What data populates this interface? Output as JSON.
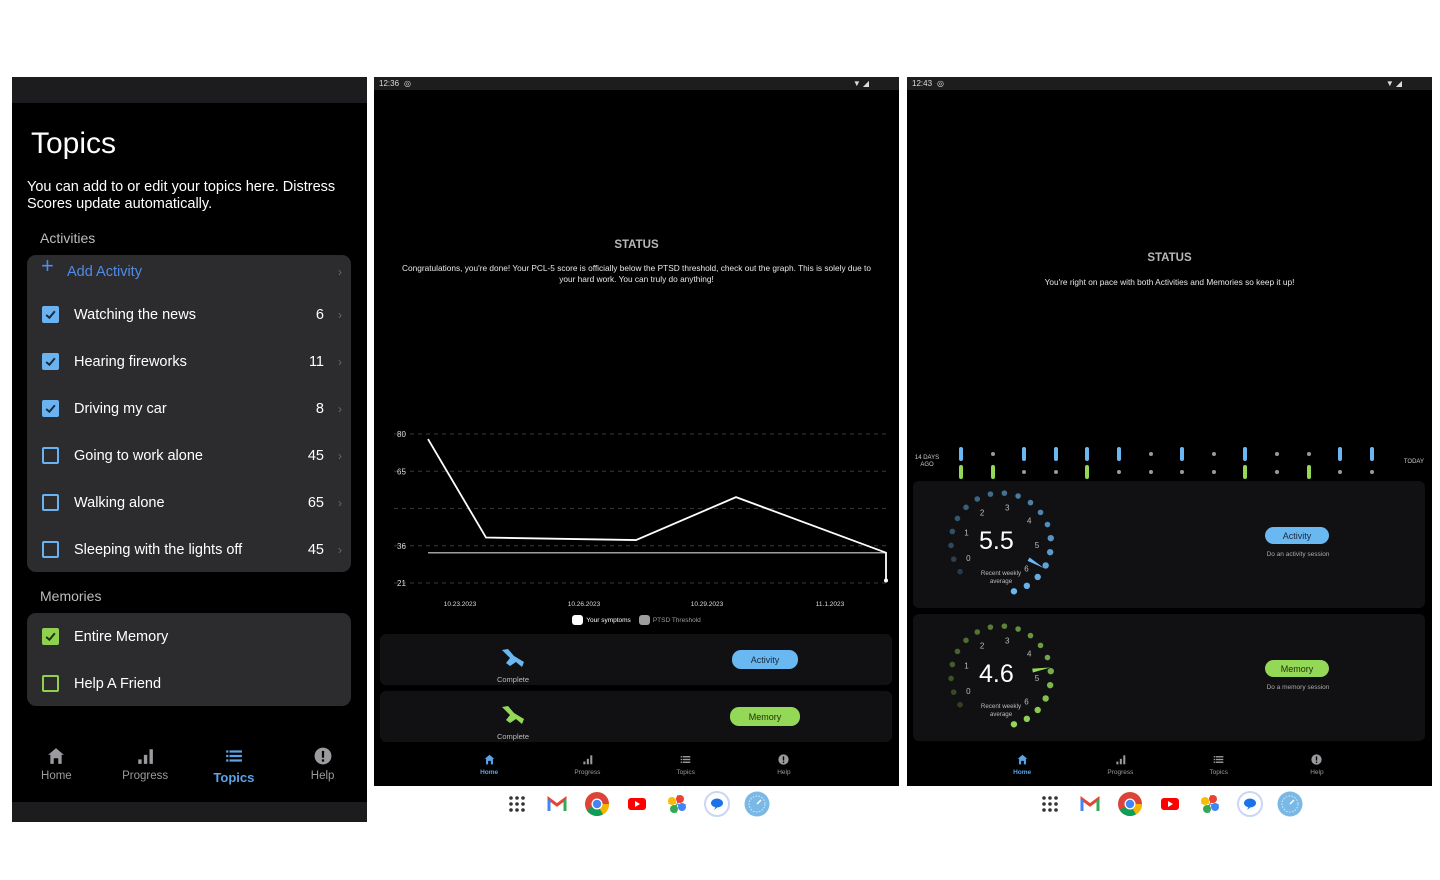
{
  "screen_topics": {
    "title": "Topics",
    "description": "You can add to or edit your topics here. Distress Scores update automatically.",
    "activities_heading": "Activities",
    "add_activity_label": "Add Activity",
    "activities": [
      {
        "label": "Watching the news",
        "score": "6",
        "checked": true
      },
      {
        "label": "Hearing fireworks",
        "score": "11",
        "checked": true
      },
      {
        "label": "Driving my car",
        "score": "8",
        "checked": true
      },
      {
        "label": "Going to work alone",
        "score": "45",
        "checked": false
      },
      {
        "label": "Walking alone",
        "score": "65",
        "checked": false
      },
      {
        "label": "Sleeping with the lights off",
        "score": "45",
        "checked": false
      }
    ],
    "memories_heading": "Memories",
    "memories": [
      {
        "label": "Entire Memory",
        "checked": true
      },
      {
        "label": "Help A Friend",
        "checked": false
      }
    ],
    "nav": [
      {
        "label": "Home",
        "icon": "home-icon",
        "active": false
      },
      {
        "label": "Progress",
        "icon": "bar-chart-icon",
        "active": false
      },
      {
        "label": "Topics",
        "icon": "list-icon",
        "active": true
      },
      {
        "label": "Help",
        "icon": "alert-circle-icon",
        "active": false
      }
    ]
  },
  "screen_home_complete": {
    "status_time": "12:36",
    "status_title": "STATUS",
    "status_text": "Congratulations, you're done! Your PCL-5 score is officially below the PTSD threshold, check out the graph. This is solely due to your hard work. You can truly do anything!",
    "chart_data": {
      "type": "line",
      "title": "",
      "xlabel": "",
      "ylabel": "",
      "ylim": [
        21,
        80
      ],
      "y_ticks": [
        "80",
        "65",
        "",
        "36",
        "21"
      ],
      "x_ticks": [
        "10.23.2023",
        "10.26.2023",
        "10.29.2023",
        "11.1.2023"
      ],
      "grid": true,
      "legend_position": "bottom",
      "series": [
        {
          "name": "Your symptoms",
          "color": "#ffffff",
          "values": [
            78,
            39,
            38,
            55,
            33,
            22
          ]
        },
        {
          "name": "PTSD Threshold",
          "color": "#9e9e9e",
          "values": [
            33,
            33
          ]
        }
      ]
    },
    "sessions": [
      {
        "caption": "Complete",
        "button": "Activity",
        "icon": "bird-icon",
        "color": "blue"
      },
      {
        "caption": "Complete",
        "button": "Memory",
        "icon": "bird-icon",
        "color": "green"
      }
    ],
    "nav": [
      {
        "label": "Home",
        "active": true
      },
      {
        "label": "Progress",
        "active": false
      },
      {
        "label": "Topics",
        "active": false
      },
      {
        "label": "Help",
        "active": false
      }
    ]
  },
  "screen_home_progress": {
    "status_time": "12:43",
    "status_title": "STATUS",
    "status_text": "You're right on pace with both Activities and Memories so keep it up!",
    "streak": {
      "left_label": "14 DAYS AGO",
      "right_label": "TODAY",
      "activity_days": [
        true,
        false,
        true,
        true,
        true,
        true,
        false,
        true,
        false,
        true,
        false,
        false,
        true,
        true
      ],
      "memory_days": [
        true,
        true,
        false,
        false,
        true,
        false,
        false,
        false,
        false,
        true,
        false,
        true,
        false,
        false
      ]
    },
    "gauges": [
      {
        "value": "5.5",
        "numeric": 5.5,
        "max": 6.5,
        "caption": "Recent weekly average",
        "button": "Activity",
        "subtitle": "Do an activity session",
        "color": "#6ab8f2"
      },
      {
        "value": "4.6",
        "numeric": 4.6,
        "max": 6.5,
        "caption": "Recent weekly average",
        "button": "Memory",
        "subtitle": "Do a memory session",
        "color": "#94d857"
      }
    ],
    "gauge_ticks": [
      "0",
      "1",
      "2",
      "3",
      "4",
      "5",
      "6"
    ],
    "nav": [
      {
        "label": "Home",
        "active": true
      },
      {
        "label": "Progress",
        "active": false
      },
      {
        "label": "Topics",
        "active": false
      },
      {
        "label": "Help",
        "active": false
      }
    ]
  },
  "dock": [
    "app-drawer-icon",
    "gmail-icon",
    "chrome-icon",
    "youtube-icon",
    "photos-icon",
    "messages-icon",
    "speedometer-app-icon"
  ],
  "colors": {
    "activity_blue": "#6ab8f2",
    "memory_green": "#94d857",
    "nav_active": "#5aa4e8",
    "card_bg": "#2c2c2e"
  }
}
